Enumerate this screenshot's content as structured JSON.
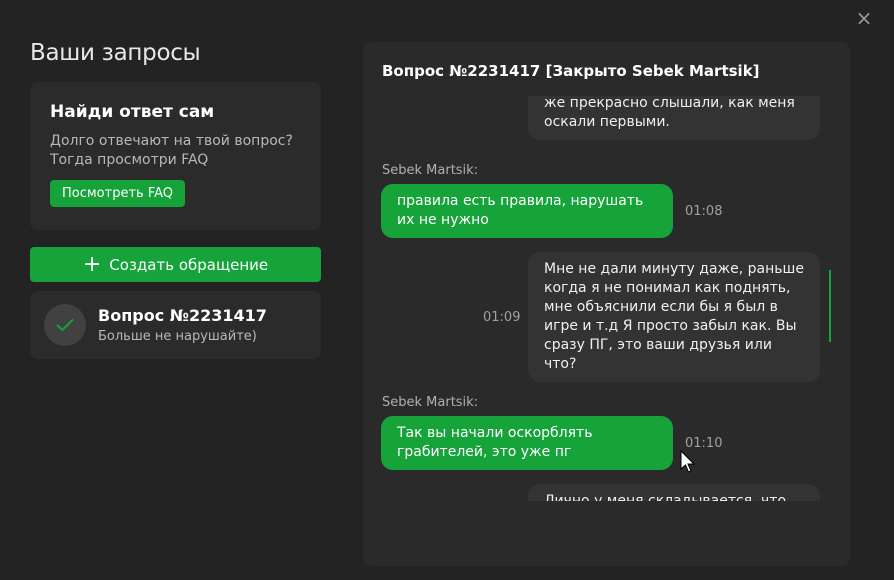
{
  "window": {
    "close_glyph": "×"
  },
  "page": {
    "title": "Ваши запросы"
  },
  "faq": {
    "title": "Найди ответ сам",
    "text": "Долго отвечают на твой вопрос? Тогда просмотри FAQ",
    "button": "Посмотреть FAQ"
  },
  "create": {
    "icon": "plus-icon",
    "label": "Создать обращение"
  },
  "ticket": {
    "icon": "check-icon",
    "title": "Вопрос №2231417",
    "subtitle": "Больше не нарушайте)"
  },
  "chat": {
    "header": "Вопрос №2231417 [Закрыто Sebek Martsik]",
    "messages": [
      {
        "side": "out",
        "author": "",
        "text": "же прекрасно слышали, как меня оскали первыми.",
        "time": ""
      },
      {
        "side": "in",
        "author": "Sebek Martsik:",
        "text": "правила есть правила, нарушать их не нужно",
        "time": "01:08"
      },
      {
        "side": "out",
        "author": "",
        "text": "Мне не дали минуту даже, раньше когда я не понимал как поднять, мне объяснили если бы я был в игре и т.д Я просто забыл как. Вы сразу ПГ, это ваши друзья или что?",
        "time": "01:09"
      },
      {
        "side": "in",
        "author": "Sebek Martsik:",
        "text": "Так вы начали оскорблять грабителей, это уже пг",
        "time": "01:10"
      },
      {
        "side": "out",
        "author": "",
        "text": "Лично у меня складывается, что",
        "time": ""
      }
    ]
  },
  "colors": {
    "accent": "#15a33a",
    "background": "#232323",
    "card": "#2b2b2b"
  }
}
